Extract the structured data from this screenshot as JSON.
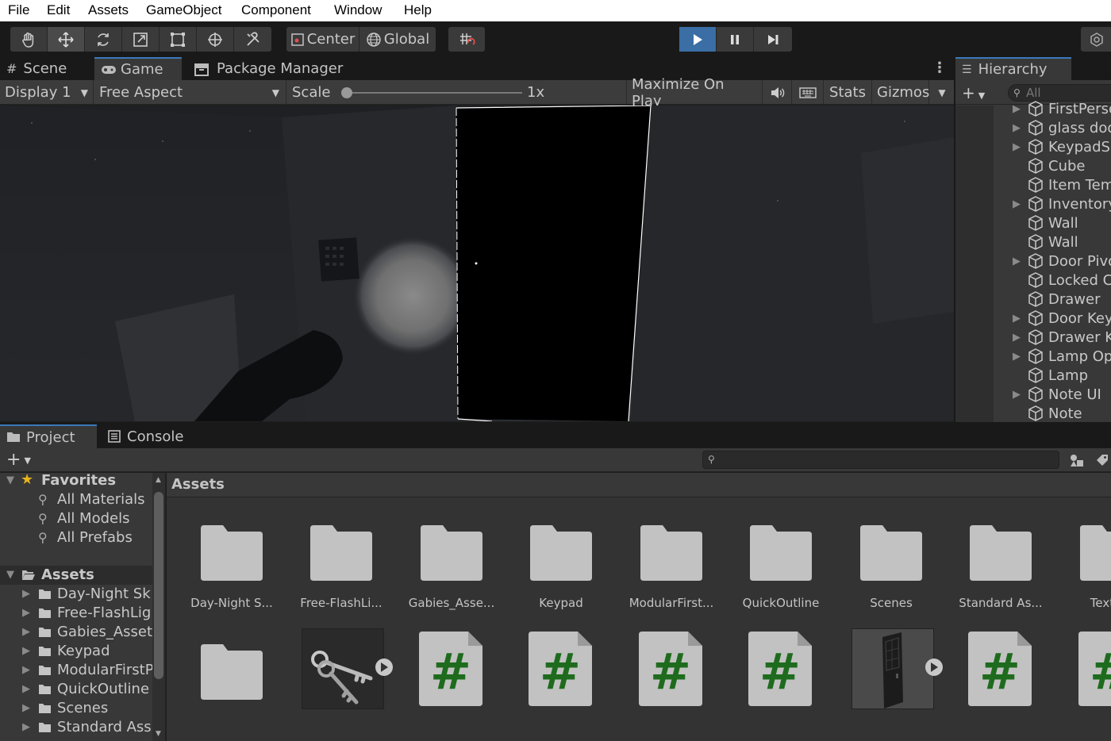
{
  "menu": [
    "File",
    "Edit",
    "Assets",
    "GameObject",
    "Component",
    "Window",
    "Help"
  ],
  "toolbar": {
    "tools": [
      "hand-tool",
      "move-tool",
      "rotate-tool",
      "scale-tool",
      "rect-tool",
      "transform-tool",
      "custom-tool"
    ],
    "pivot_label": "Center",
    "space_label": "Global",
    "play_state": "playing"
  },
  "scene_tabs": {
    "scene": "Scene",
    "game": "Game",
    "package_manager": "Package Manager"
  },
  "game_bar": {
    "display": "Display 1",
    "aspect": "Free Aspect",
    "scale_label": "Scale",
    "scale_value": "1x",
    "maximize": "Maximize On Play",
    "stats": "Stats",
    "gizmos": "Gizmos"
  },
  "hierarchy": {
    "title": "Hierarchy",
    "search_placeholder": "All",
    "items": [
      {
        "label": "FirstPerso",
        "expandable": true
      },
      {
        "label": "glass doo",
        "expandable": true
      },
      {
        "label": "KeypadSc",
        "expandable": true
      },
      {
        "label": "Cube",
        "expandable": false
      },
      {
        "label": "Item Tem",
        "expandable": false
      },
      {
        "label": "Inventory",
        "expandable": true
      },
      {
        "label": "Wall",
        "expandable": false
      },
      {
        "label": "Wall",
        "expandable": false
      },
      {
        "label": "Door Pivo",
        "expandable": true
      },
      {
        "label": "Locked C",
        "expandable": false
      },
      {
        "label": "Drawer",
        "expandable": false
      },
      {
        "label": "Door Key",
        "expandable": true
      },
      {
        "label": "Drawer K",
        "expandable": true
      },
      {
        "label": "Lamp Op",
        "expandable": true
      },
      {
        "label": "Lamp",
        "expandable": false
      },
      {
        "label": "Note UI",
        "expandable": true
      },
      {
        "label": "Note",
        "expandable": false
      }
    ]
  },
  "project_tabs": {
    "project": "Project",
    "console": "Console"
  },
  "project_tree": {
    "favorites": "Favorites",
    "favorite_items": [
      "All Materials",
      "All Models",
      "All Prefabs"
    ],
    "assets": "Assets",
    "asset_folders": [
      "Day-Night Sk",
      "Free-FlashLig",
      "Gabies_Asset",
      "Keypad",
      "ModularFirstP",
      "QuickOutline",
      "Scenes",
      "Standard Ass"
    ]
  },
  "assets_panel": {
    "breadcrumb": "Assets",
    "row1": [
      "Day-Night S...",
      "Free-FlashLi...",
      "Gabies_Asse...",
      "Keypad",
      "ModularFirst...",
      "QuickOutline",
      "Scenes",
      "Standard As...",
      "TextMe"
    ],
    "row2_types": [
      "folder",
      "keys-prefab",
      "script",
      "script",
      "script",
      "script",
      "door-prefab",
      "script",
      "script"
    ]
  },
  "colors": {
    "accent": "#3a79bb",
    "play_active": "#3a6ea5",
    "script_green": "#1e6b1e"
  }
}
